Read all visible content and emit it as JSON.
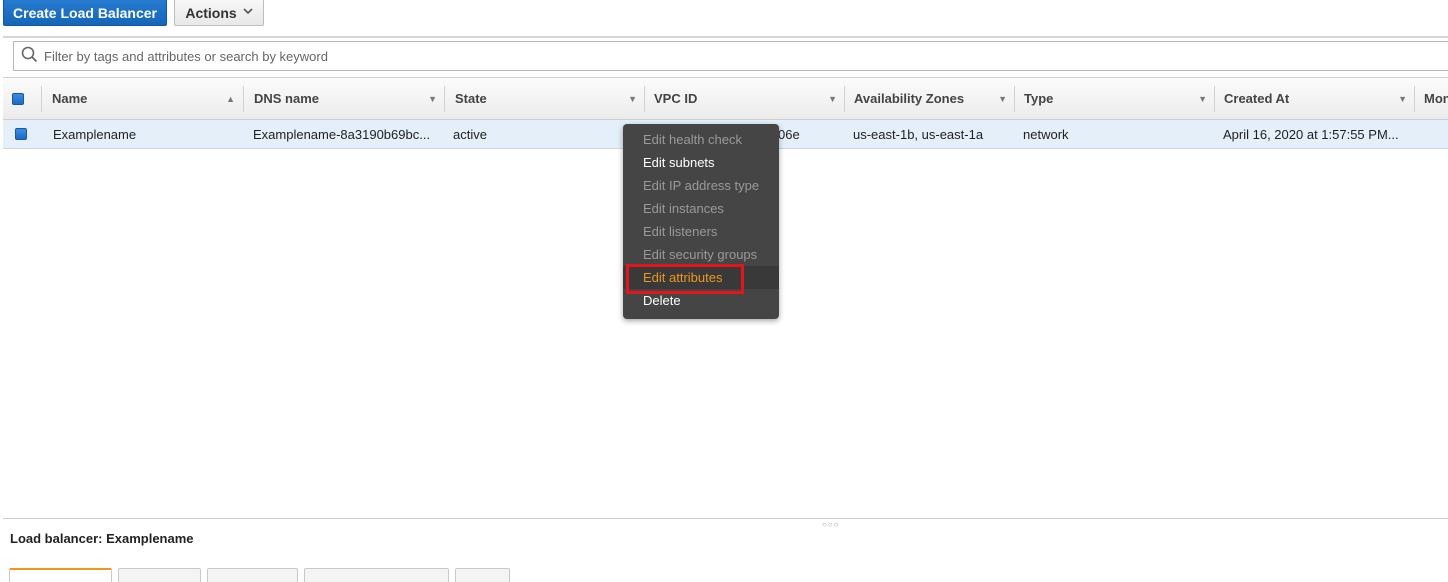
{
  "toolbar": {
    "create_label": "Create Load Balancer",
    "actions_label": "Actions"
  },
  "search": {
    "placeholder": "Filter by tags and attributes or search by keyword"
  },
  "table": {
    "columns": [
      "Name",
      "DNS name",
      "State",
      "VPC ID",
      "Availability Zones",
      "Type",
      "Created At",
      "Mon"
    ],
    "rows": [
      {
        "name": "Examplename",
        "dns": "Examplename-8a3190b69bc...",
        "state": "active",
        "vpc": "06e",
        "zones": "us-east-1b, us-east-1a",
        "type": "network",
        "created": "April 16, 2020 at 1:57:55 PM..."
      }
    ]
  },
  "actions_menu": {
    "items": [
      {
        "label": "Edit health check",
        "state": "disabled"
      },
      {
        "label": "Edit subnets",
        "state": "enabled"
      },
      {
        "label": "Edit IP address type",
        "state": "disabled"
      },
      {
        "label": "Edit instances",
        "state": "disabled"
      },
      {
        "label": "Edit listeners",
        "state": "disabled"
      },
      {
        "label": "Edit security groups",
        "state": "disabled"
      },
      {
        "label": "Edit attributes",
        "state": "active"
      },
      {
        "label": "Delete",
        "state": "enabled"
      }
    ],
    "highlight_color": "#e2141c",
    "active_color": "#f0951e"
  },
  "detail": {
    "title": "Load balancer: Examplename"
  },
  "colors": {
    "primary": "#1a6ac6",
    "row_selected": "#e4effa",
    "menu_bg": "#454545"
  }
}
